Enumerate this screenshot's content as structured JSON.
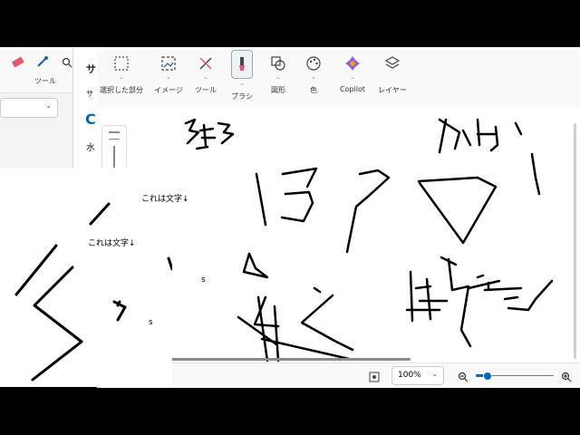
{
  "back_window": {
    "toolbar_label": "ツール",
    "panel_char_1": "サ",
    "panel_char_2": "サ",
    "panel_char_3": "C",
    "panel_char_4": "水"
  },
  "ribbon": {
    "items": [
      {
        "label": "選択した部分",
        "icon": "selection-icon"
      },
      {
        "label": "イメージ",
        "icon": "image-icon"
      },
      {
        "label": "ツール",
        "icon": "tools-icon"
      },
      {
        "label": "ブラシ",
        "icon": "brush-icon"
      },
      {
        "label": "図形",
        "icon": "shapes-icon"
      },
      {
        "label": "色",
        "icon": "palette-icon"
      },
      {
        "label": "Copilot",
        "icon": "copilot-icon"
      },
      {
        "label": "レイヤー",
        "icon": "layers-icon"
      }
    ]
  },
  "overlay": {
    "text_1": "これは文字↓",
    "text_2": "これは文字↓",
    "s_1": "s",
    "s_2": "s"
  },
  "status": {
    "zoom": "100%"
  },
  "colors": {
    "accent": "#0067c0",
    "ribbon_bg": "#f9f9f9"
  }
}
